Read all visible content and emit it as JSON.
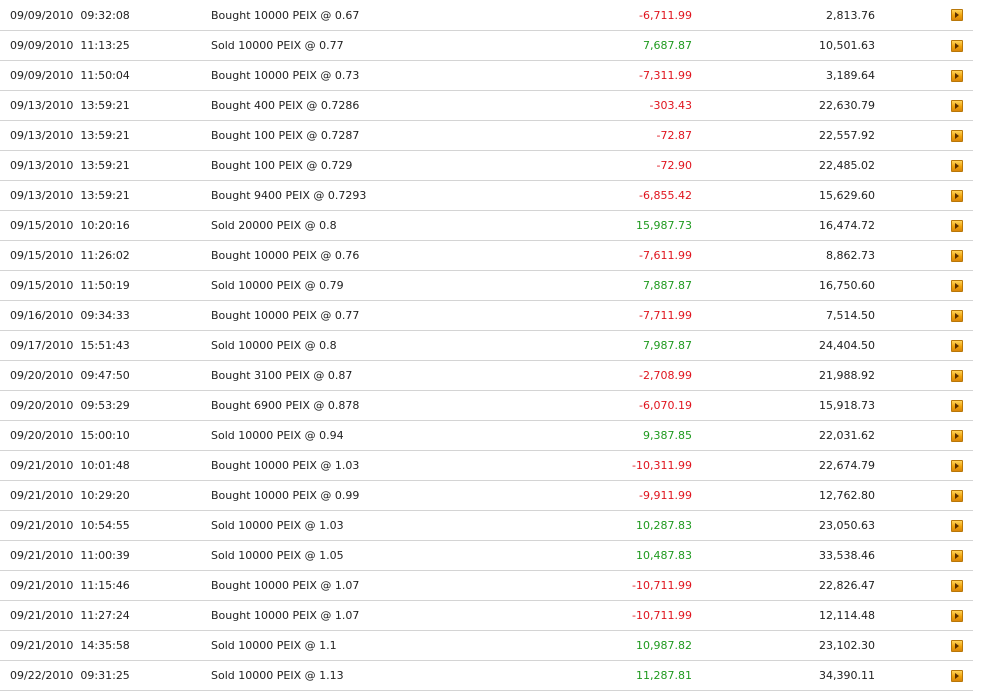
{
  "colors": {
    "negative": "#e0141e",
    "positive": "#1f9a1f",
    "divider": "#d4d4d4",
    "action_button": "#f0a30a"
  },
  "rows": [
    {
      "date": "09/09/2010",
      "time": "09:32:08",
      "description": "Bought 10000 PEIX @ 0.67",
      "amount": "-6,711.99",
      "balance": "2,813.76",
      "action_icon": "play-arrow-icon"
    },
    {
      "date": "09/09/2010",
      "time": "11:13:25",
      "description": "Sold 10000 PEIX @ 0.77",
      "amount": "7,687.87",
      "balance": "10,501.63",
      "action_icon": "play-arrow-icon"
    },
    {
      "date": "09/09/2010",
      "time": "11:50:04",
      "description": "Bought 10000 PEIX @ 0.73",
      "amount": "-7,311.99",
      "balance": "3,189.64",
      "action_icon": "play-arrow-icon"
    },
    {
      "date": "09/13/2010",
      "time": "13:59:21",
      "description": "Bought 400 PEIX @ 0.7286",
      "amount": "-303.43",
      "balance": "22,630.79",
      "action_icon": "play-arrow-icon"
    },
    {
      "date": "09/13/2010",
      "time": "13:59:21",
      "description": "Bought 100 PEIX @ 0.7287",
      "amount": "-72.87",
      "balance": "22,557.92",
      "action_icon": "play-arrow-icon"
    },
    {
      "date": "09/13/2010",
      "time": "13:59:21",
      "description": "Bought 100 PEIX @ 0.729",
      "amount": "-72.90",
      "balance": "22,485.02",
      "action_icon": "play-arrow-icon"
    },
    {
      "date": "09/13/2010",
      "time": "13:59:21",
      "description": "Bought 9400 PEIX @ 0.7293",
      "amount": "-6,855.42",
      "balance": "15,629.60",
      "action_icon": "play-arrow-icon"
    },
    {
      "date": "09/15/2010",
      "time": "10:20:16",
      "description": "Sold 20000 PEIX @ 0.8",
      "amount": "15,987.73",
      "balance": "16,474.72",
      "action_icon": "play-arrow-icon"
    },
    {
      "date": "09/15/2010",
      "time": "11:26:02",
      "description": "Bought 10000 PEIX @ 0.76",
      "amount": "-7,611.99",
      "balance": "8,862.73",
      "action_icon": "play-arrow-icon"
    },
    {
      "date": "09/15/2010",
      "time": "11:50:19",
      "description": "Sold 10000 PEIX @ 0.79",
      "amount": "7,887.87",
      "balance": "16,750.60",
      "action_icon": "play-arrow-icon"
    },
    {
      "date": "09/16/2010",
      "time": "09:34:33",
      "description": "Bought 10000 PEIX @ 0.77",
      "amount": "-7,711.99",
      "balance": "7,514.50",
      "action_icon": "play-arrow-icon"
    },
    {
      "date": "09/17/2010",
      "time": "15:51:43",
      "description": "Sold 10000 PEIX @ 0.8",
      "amount": "7,987.87",
      "balance": "24,404.50",
      "action_icon": "play-arrow-icon"
    },
    {
      "date": "09/20/2010",
      "time": "09:47:50",
      "description": "Bought 3100 PEIX @ 0.87",
      "amount": "-2,708.99",
      "balance": "21,988.92",
      "action_icon": "play-arrow-icon"
    },
    {
      "date": "09/20/2010",
      "time": "09:53:29",
      "description": "Bought 6900 PEIX @ 0.878",
      "amount": "-6,070.19",
      "balance": "15,918.73",
      "action_icon": "play-arrow-icon"
    },
    {
      "date": "09/20/2010",
      "time": "15:00:10",
      "description": "Sold 10000 PEIX @ 0.94",
      "amount": "9,387.85",
      "balance": "22,031.62",
      "action_icon": "play-arrow-icon"
    },
    {
      "date": "09/21/2010",
      "time": "10:01:48",
      "description": "Bought 10000 PEIX @ 1.03",
      "amount": "-10,311.99",
      "balance": "22,674.79",
      "action_icon": "play-arrow-icon"
    },
    {
      "date": "09/21/2010",
      "time": "10:29:20",
      "description": "Bought 10000 PEIX @ 0.99",
      "amount": "-9,911.99",
      "balance": "12,762.80",
      "action_icon": "play-arrow-icon"
    },
    {
      "date": "09/21/2010",
      "time": "10:54:55",
      "description": "Sold 10000 PEIX @ 1.03",
      "amount": "10,287.83",
      "balance": "23,050.63",
      "action_icon": "play-arrow-icon"
    },
    {
      "date": "09/21/2010",
      "time": "11:00:39",
      "description": "Sold 10000 PEIX @ 1.05",
      "amount": "10,487.83",
      "balance": "33,538.46",
      "action_icon": "play-arrow-icon"
    },
    {
      "date": "09/21/2010",
      "time": "11:15:46",
      "description": "Bought 10000 PEIX @ 1.07",
      "amount": "-10,711.99",
      "balance": "22,826.47",
      "action_icon": "play-arrow-icon"
    },
    {
      "date": "09/21/2010",
      "time": "11:27:24",
      "description": "Bought 10000 PEIX @ 1.07",
      "amount": "-10,711.99",
      "balance": "12,114.48",
      "action_icon": "play-arrow-icon"
    },
    {
      "date": "09/21/2010",
      "time": "14:35:58",
      "description": "Sold 10000 PEIX @ 1.1",
      "amount": "10,987.82",
      "balance": "23,102.30",
      "action_icon": "play-arrow-icon"
    },
    {
      "date": "09/22/2010",
      "time": "09:31:25",
      "description": "Sold 10000 PEIX @ 1.13",
      "amount": "11,287.81",
      "balance": "34,390.11",
      "action_icon": "play-arrow-icon"
    }
  ]
}
